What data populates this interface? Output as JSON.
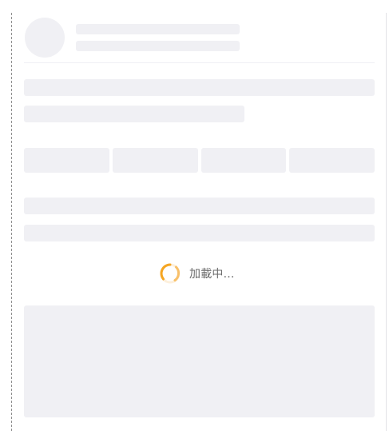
{
  "loading": {
    "text": "加載中..."
  },
  "colors": {
    "skeleton": "#f0f0f4",
    "spinner_orange": "#f5a623",
    "spinner_light": "#fde8c7",
    "text": "#6a6a6a"
  },
  "icons": {
    "spinner": "loading-spinner-icon"
  }
}
